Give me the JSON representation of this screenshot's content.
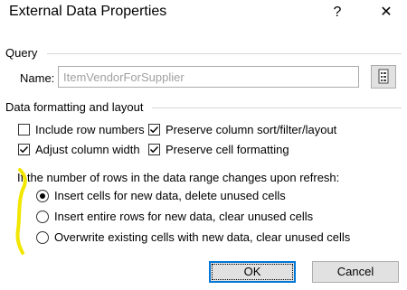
{
  "window": {
    "title": "External Data Properties",
    "help_glyph": "?",
    "close_glyph": "✕"
  },
  "query": {
    "section_label": "Query",
    "name_label": "Name:",
    "name_value": "ItemVendorForSupplier",
    "picker_icon": "properties-list-icon"
  },
  "formatting": {
    "section_label": "Data formatting and layout",
    "include_row_numbers": {
      "label": "Include row numbers",
      "checked": false
    },
    "adjust_column_width": {
      "label": "Adjust column width",
      "checked": true
    },
    "preserve_sort": {
      "label": "Preserve column sort/filter/layout",
      "checked": true
    },
    "preserve_formatting": {
      "label": "Preserve cell formatting",
      "checked": true
    }
  },
  "refresh": {
    "question": "If the number of rows in the data range changes upon refresh:",
    "options": [
      {
        "label": "Insert cells for new data, delete unused cells",
        "selected": true
      },
      {
        "label": "Insert entire rows for new data, clear unused cells",
        "selected": false
      },
      {
        "label": "Overwrite existing cells with new data, clear unused cells",
        "selected": false
      }
    ]
  },
  "buttons": {
    "ok": "OK",
    "cancel": "Cancel"
  },
  "colors": {
    "accent": "#0078d7",
    "highlighter": "#f2e600"
  }
}
